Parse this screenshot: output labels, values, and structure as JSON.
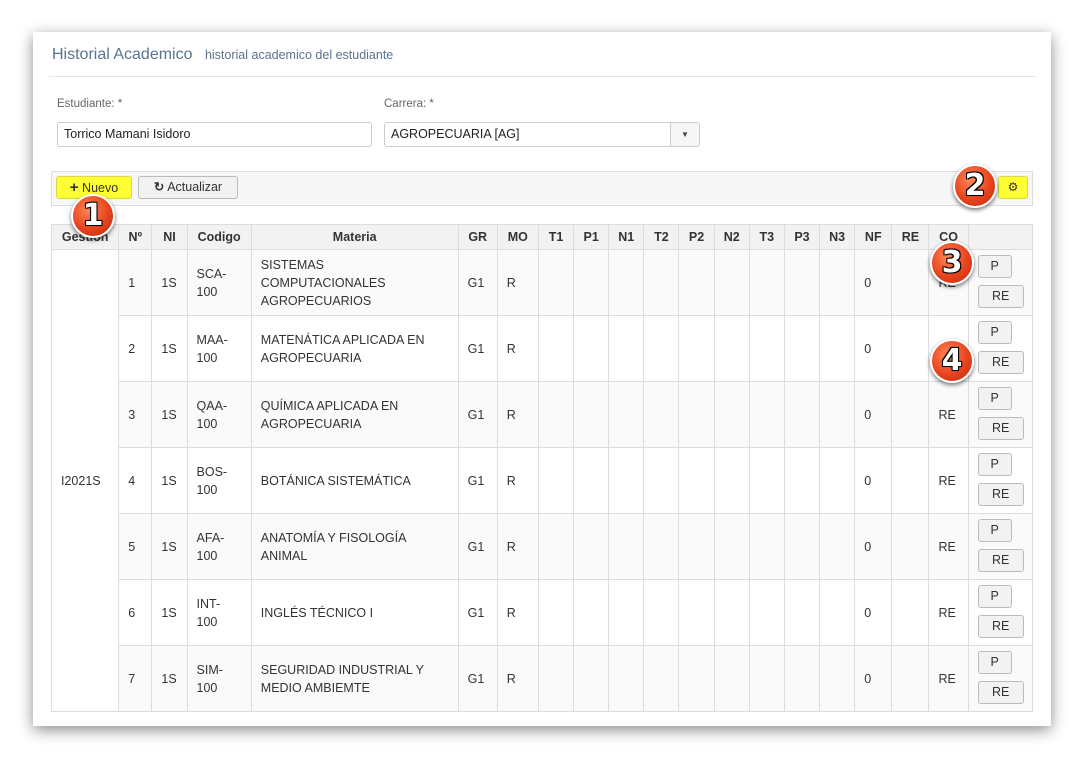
{
  "header": {
    "title": "Historial Academico",
    "subtitle": "historial academico del estudiante"
  },
  "form": {
    "student_label": "Estudiante:",
    "student_required": "*",
    "student_value": "Torrico  Mamani Isidoro",
    "career_label": "Carrera:",
    "career_required": "*",
    "career_value": "AGROPECUARIA [AG]"
  },
  "toolbar": {
    "new_label": "Nuevo",
    "refresh_label": "Actualizar",
    "icons": {
      "new": "plus-icon",
      "refresh": "refresh-icon",
      "settings": "gear-icon"
    }
  },
  "table": {
    "columns": [
      "Gestion",
      "Nº",
      "NI",
      "Codigo",
      "Materia",
      "GR",
      "MO",
      "T1",
      "P1",
      "N1",
      "T2",
      "P2",
      "N2",
      "T3",
      "P3",
      "N3",
      "NF",
      "RE",
      "CO",
      ""
    ],
    "gestion": "I2021S",
    "rows": [
      {
        "n": "1",
        "ni": "1S",
        "codigo": "SCA-\n100",
        "materia": "SISTEMAS\nCOMPUTACIONALES\nAGROPECUARIOS",
        "gr": "G1",
        "mo": "R",
        "nf": "0",
        "re": "",
        "co": "RE"
      },
      {
        "n": "2",
        "ni": "1S",
        "codigo": "MAA-\n100",
        "materia": "MATENÁTICA APLICADA EN\nAGROPECUARIA",
        "gr": "G1",
        "mo": "R",
        "nf": "0",
        "re": "",
        "co": "RE"
      },
      {
        "n": "3",
        "ni": "1S",
        "codigo": "QAA-\n100",
        "materia": "QUÍMICA APLICADA EN\nAGROPECUARIA",
        "gr": "G1",
        "mo": "R",
        "nf": "0",
        "re": "",
        "co": "RE"
      },
      {
        "n": "4",
        "ni": "1S",
        "codigo": "BOS-\n100",
        "materia": "BOTÁNICA SISTEMÁTICA",
        "gr": "G1",
        "mo": "R",
        "nf": "0",
        "re": "",
        "co": "RE"
      },
      {
        "n": "5",
        "ni": "1S",
        "codigo": "AFA-\n100",
        "materia": "ANATOMÍA Y FISOLOGÍA\nANIMAL",
        "gr": "G1",
        "mo": "R",
        "nf": "0",
        "re": "",
        "co": "RE"
      },
      {
        "n": "6",
        "ni": "1S",
        "codigo": "INT-\n100",
        "materia": "INGLÉS TÉCNICO I",
        "gr": "G1",
        "mo": "R",
        "nf": "0",
        "re": "",
        "co": "RE"
      },
      {
        "n": "7",
        "ni": "1S",
        "codigo": "SIM-\n100",
        "materia": "SEGURIDAD INDUSTRIAL Y\nMEDIO AMBIEMTE",
        "gr": "G1",
        "mo": "R",
        "nf": "0",
        "re": "",
        "co": "RE"
      }
    ],
    "p_label": "P",
    "re_label": "RE"
  },
  "callouts": [
    "1",
    "2",
    "3",
    "4"
  ],
  "colors": {
    "highlight": "#ffff33",
    "callout": "#e8431e",
    "title": "#5a7491"
  }
}
